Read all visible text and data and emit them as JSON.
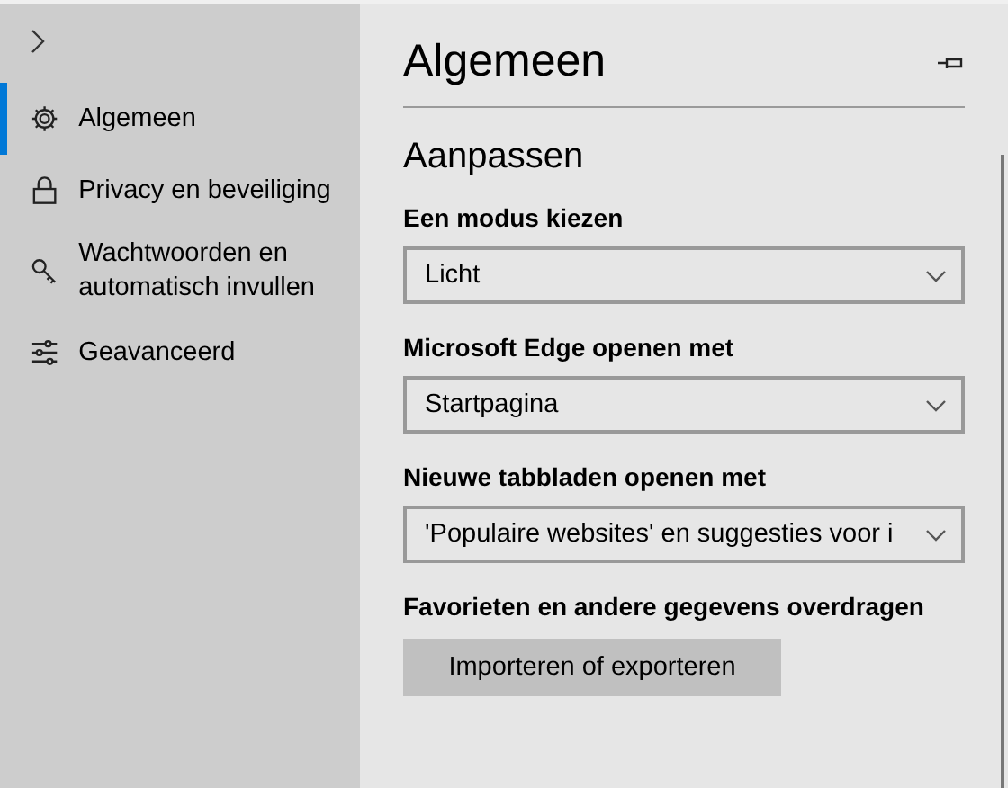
{
  "sidebar": {
    "items": [
      {
        "label": "Algemeen",
        "selected": true
      },
      {
        "label": "Privacy en beveiliging",
        "selected": false
      },
      {
        "label": "Wachtwoorden en automatisch invullen",
        "selected": false
      },
      {
        "label": "Geavanceerd",
        "selected": false
      }
    ]
  },
  "panel": {
    "title": "Algemeen",
    "section": "Aanpassen",
    "settings": [
      {
        "label": "Een modus kiezen",
        "value": "Licht"
      },
      {
        "label": "Microsoft Edge openen met",
        "value": "Startpagina"
      },
      {
        "label": "Nieuwe tabbladen openen met",
        "value": "'Populaire websites' en suggesties voor i"
      }
    ],
    "transfer": {
      "label": "Favorieten en andere gegevens overdragen",
      "button": "Importeren of exporteren"
    }
  }
}
